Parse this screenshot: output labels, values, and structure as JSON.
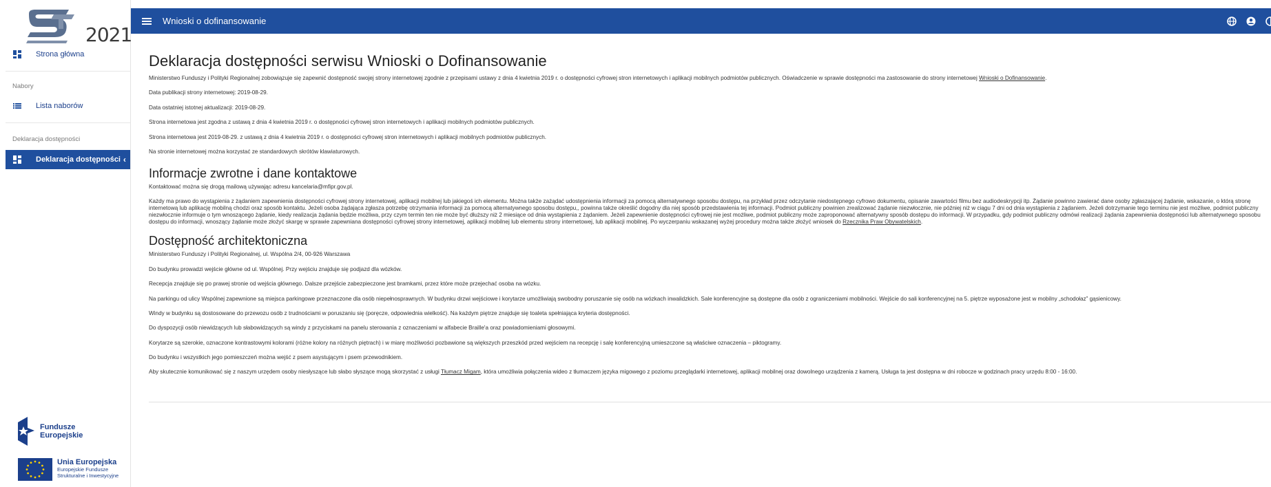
{
  "colors": {
    "primary": "#1f4f9e",
    "text": "#333333"
  },
  "sidebar": {
    "logo_year": "2021",
    "home_label": "Strona główna",
    "section_nabory": "Nabory",
    "lista_label": "Lista naborów",
    "section_deklaracja": "Deklaracja dostępności",
    "deklaracja_label": "Deklaracja dostępności",
    "fe_line1": "Fundusze",
    "fe_line2": "Europejskie",
    "ue_title": "Unia Europejska",
    "ue_sub1": "Europejskie Fundusze",
    "ue_sub2": "Strukturalne i Inwestycyjne"
  },
  "topbar": {
    "title": "Wnioski o dofinansowanie",
    "icons": [
      "globe-icon",
      "user-icon",
      "contrast-icon"
    ]
  },
  "main": {
    "title": "Deklaracja dostępności serwisu Wnioski o Dofinansowanie",
    "intro_pre": "Ministerstwo Funduszy i Polityki Regionalnej zobowiązuje się zapewnić dostępność swojej strony internetowej zgodnie z przepisami ustawy z dnia 4 kwietnia 2019 r. o dostępności cyfrowej stron internetowych i aplikacji mobilnych podmiotów publicznych. Oświadczenie w sprawie dostępności ma zastosowanie do strony internetowej ",
    "intro_link": "Wnioski o Dofinansowanie",
    "intro_post": ".",
    "pub_date": "Data publikacji strony internetowej: 2019-08-29.",
    "upd_date": "Data ostatniej istotnej aktualizacji: 2019-08-29.",
    "compliance1": "Strona internetowa jest zgodna z ustawą z dnia 4 kwietnia 2019 r. o dostępności cyfrowej stron internetowych i aplikacji mobilnych podmiotów publicznych.",
    "compliance2": "Strona internetowa jest 2019-08-29. z ustawą z dnia 4 kwietnia 2019 r. o dostępności cyfrowej stron internetowych i aplikacji mobilnych podmiotów publicznych.",
    "shortcuts": "Na stronie internetowej można korzystać ze standardowych skrótów klawiaturowych.",
    "feedback_title": "Informacje zwrotne i dane kontaktowe",
    "contact": "Kontaktować można się drogą mailową używając adresu kancelaria@mfipr.gov.pl.",
    "rights_pre": "Każdy ma prawo do wystąpienia z żądaniem zapewnienia dostępności cyfrowej strony internetowej, aplikacji mobilnej lub jakiegoś ich elementu. Można także zażądać udostępnienia informacji za pomocą alternatywnego sposobu dostępu, na przykład przez odczytanie niedostępnego cyfrowo dokumentu, opisanie zawartości filmu bez audiodeskrypcji itp. Żądanie powinno zawierać dane osoby zgłaszającej żądanie, wskazanie, o którą stronę internetową lub aplikację mobilną chodzi oraz sposób kontaktu. Jeżeli osoba żądająca zgłasza potrzebę otrzymania informacji za pomocą alternatywnego sposobu dostępu,, powinna także określić dogodny dla niej sposób przedstawienia tej informacji. Podmiot publiczny powinien zrealizować żądanie niezwłocznie, nie później niż w ciągu 7 dni od dnia wystąpienia z żądaniem. Jeżeli dotrzymanie tego terminu nie jest możliwe, podmiot publiczny niezwłocznie informuje o tym wnoszącego żądanie, kiedy realizacja żądania będzie możliwa, przy czym termin ten nie może być dłuższy niż 2 miesiące od dnia wystąpienia z żądaniem. Jeżeli zapewnienie dostępności cyfrowej nie jest możliwe, podmiot publiczny może zaproponować alternatywny sposób dostępu do informacji. W przypadku, gdy podmiot publiczny odmówi realizacji żądania zapewnienia dostępności lub alternatywnego sposobu dostępu do informacji, wnoszący żądanie może złożyć skargę w sprawie zapewniana dostępności cyfrowej strony internetowej, aplikacji mobilnej lub elementu strony internetowej, lub aplikacji mobilnej. Po wyczerpaniu wskazanej wyżej procedury można także złożyć wniosek do ",
    "rights_link": "Rzecznika Praw Obywatelskich",
    "rights_post": ".",
    "arch_title": "Dostępność architektoniczna",
    "address": "Ministerstwo Funduszy i Polityki Regionalnej, ul. Wspólna 2/4, 00-926 Warszawa",
    "arch1": "Do budynku prowadzi wejście główne od ul. Wspólnej. Przy wejściu znajduje się podjazd dla wózków.",
    "arch2": "Recepcja znajduje się po prawej stronie od wejścia głównego. Dalsze przejście zabezpieczone jest bramkami, przez które może przejechać osoba na wózku.",
    "arch3": "Na parkingu od ulicy Wspólnej zapewnione są miejsca parkingowe przeznaczone dla osób niepełnosprawnych. W budynku drzwi wejściowe i korytarze umożliwiają swobodny poruszanie się osób na wózkach inwalidzkich. Sale konferencyjne są dostępne dla osób z ograniczeniami mobilności. Wejście do sali konferencyjnej na 5. piętrze wyposażone jest w mobilny „schodołaz” gąsienicowy.",
    "arch4": "Windy w budynku są dostosowane do przewozu osób z trudnościami w poruszaniu się (poręcze, odpowiednia wielkość). Na każdym piętrze znajduje się toaleta spełniająca kryteria dostępności.",
    "arch5": "Do dyspozycji osób niewidzących lub słabowidzących są windy z przyciskami na panelu sterowania z oznaczeniami w alfabecie Braille'a oraz powiadomieniami głosowymi.",
    "arch6": "Korytarze są szerokie, oznaczone kontrastowymi kolorami (różne kolory na różnych piętrach) i w miarę możliwości pozbawione są większych przeszkód przed wejściem na recepcję i salę konferencyjną umieszczone są właściwe oznaczenia – piktogramy.",
    "arch7": "Do budynku i wszystkich jego pomieszczeń można wejść z psem asystującym i psem przewodnikiem.",
    "arch8_pre": "Aby skutecznie komunikować się z naszym urzędem osoby niesłyszące lub słabo słyszące mogą skorzystać z usługi ",
    "arch8_link": "Tłumacz Migam",
    "arch8_post": ", która umożliwia połączenia wideo z tłumaczem języka migowego z poziomu przeglądarki internetowej, aplikacji mobilnej oraz dowolnego urządzenia z kamerą. Usługa ta jest dostępna w dni robocze w godzinach pracy urzędu 8:00 - 16:00."
  }
}
